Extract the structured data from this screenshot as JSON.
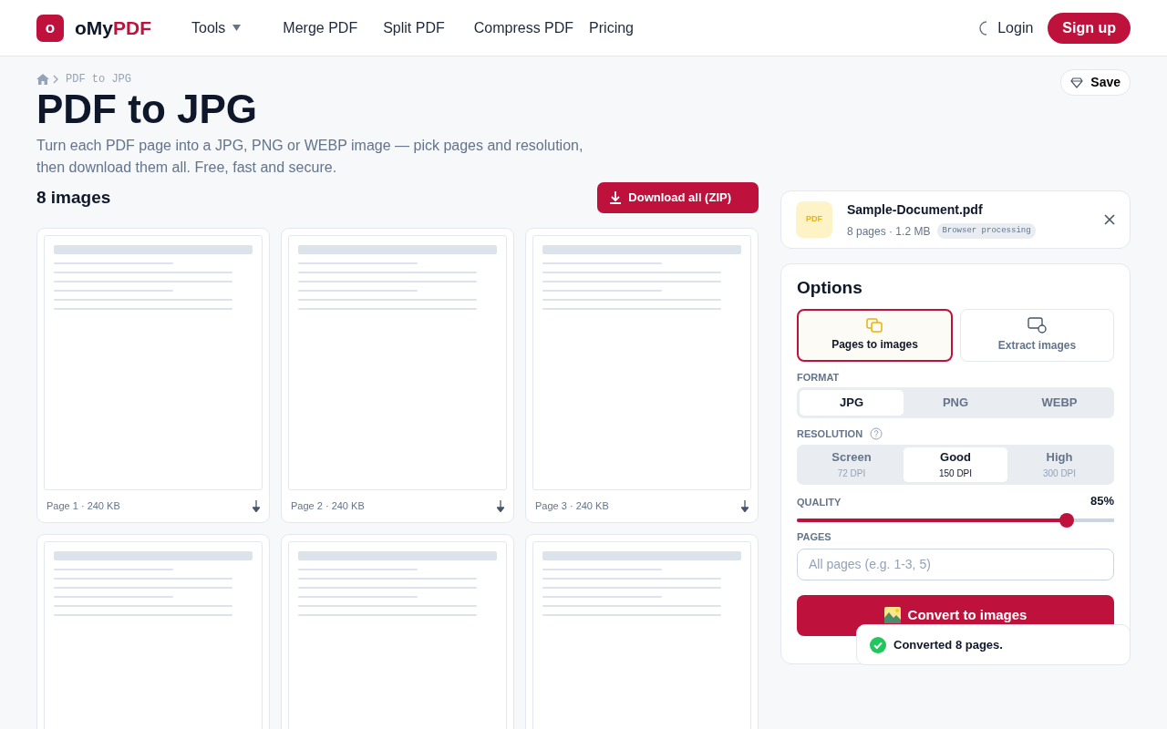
{
  "brand": {
    "logo_letter": "o",
    "name_plain": "oMy",
    "name_accent": "PDF"
  },
  "nav": [
    {
      "label": "Tools",
      "dropdown": true
    },
    {
      "label": "Merge PDF",
      "dropdown": false
    },
    {
      "label": "Split PDF",
      "dropdown": false
    },
    {
      "label": "Compress PDF",
      "dropdown": false
    },
    {
      "label": "Pricing",
      "dropdown": false
    }
  ],
  "auth": {
    "login": "Login",
    "signup": "Sign up"
  },
  "breadcrumb": {
    "current": "PDF to JPG"
  },
  "save_button": "Save",
  "title": "PDF to JPG",
  "subtitle": "Turn each PDF page into a JPG, PNG or WEBP image — pick pages and resolution, then download them all. Free, fast and secure.",
  "results": {
    "count": "8 images",
    "download_all": "Download all (ZIP)"
  },
  "pages": [
    {
      "kind": "full",
      "label": "Page 1 · 240 KB"
    },
    {
      "kind": "full",
      "label": "Page 2 · 240 KB"
    },
    {
      "kind": "full",
      "label": "Page 3 · 240 KB"
    },
    {
      "kind": "cut"
    },
    {
      "kind": "cut"
    },
    {
      "kind": "cut"
    }
  ],
  "file": {
    "badge": "PDF",
    "name": "Sample-Document.pdf",
    "meta": "8 pages · 1.2 MB",
    "tag": "Browser processing"
  },
  "options": {
    "title": "Options",
    "modes": [
      {
        "label": "Pages to images",
        "selected": true
      },
      {
        "label": "Extract images",
        "selected": false
      }
    ],
    "format_label": "FORMAT",
    "formats": [
      {
        "label": "JPG",
        "selected": true
      },
      {
        "label": "PNG",
        "selected": false
      },
      {
        "label": "WEBP",
        "selected": false
      }
    ],
    "resolution_label": "RESOLUTION",
    "resolutions": [
      {
        "label": "Screen",
        "dpi": "72 DPI",
        "selected": false
      },
      {
        "label": "Good",
        "dpi": "150 DPI",
        "selected": true
      },
      {
        "label": "High",
        "dpi": "300 DPI",
        "selected": false
      }
    ],
    "quality_label": "QUALITY",
    "quality_reading": "85%",
    "quality": {
      "level": 0.85
    },
    "pages_label": "PAGES",
    "pages_placeholder": "All pages (e.g. 1-3, 5)",
    "convert": "Convert to images"
  },
  "toast": {
    "message": "Converted 8 pages."
  }
}
